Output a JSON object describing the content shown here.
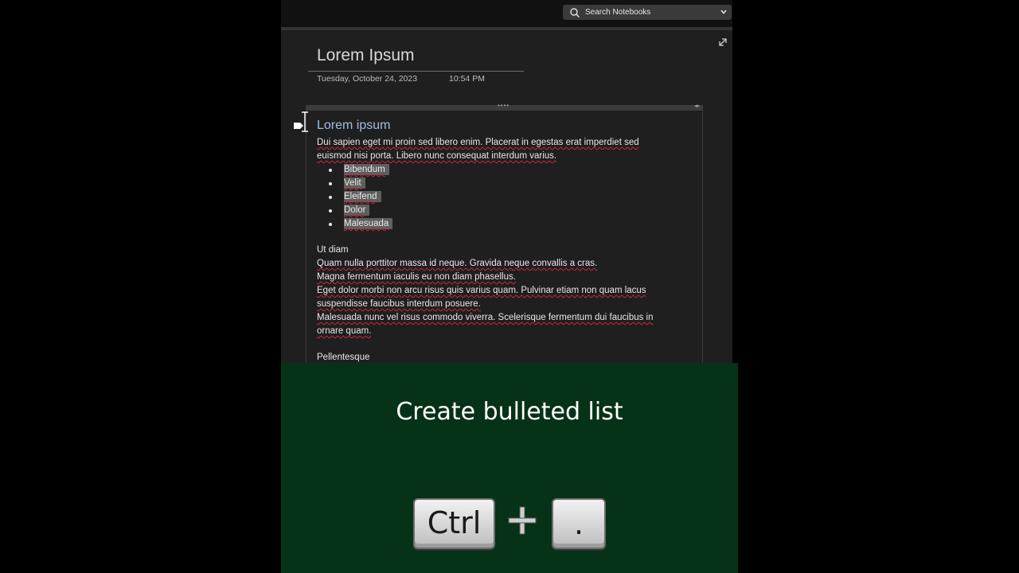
{
  "app": {
    "search": {
      "placeholder": "Search Notebooks",
      "icon": "search-icon",
      "dropdown_icon": "chevron-down-icon"
    },
    "expand_icon": "expand-icon"
  },
  "page": {
    "title": "Lorem Ipsum",
    "date": "Tuesday, October 24, 2023",
    "time": "10:54 PM"
  },
  "note": {
    "heading": "Lorem ipsum",
    "intro_lines": [
      "Dui sapien eget mi proin sed libero enim. Placerat in egestas erat imperdiet sed",
      "euismod nisi porta. Libero nunc consequat interdum varius."
    ],
    "bullets": [
      "Bibendum",
      "Velit",
      "Eleifend",
      "Dolor",
      "Malesuada"
    ],
    "section2_title": "Ut diam",
    "section2_lines": [
      "Quam nulla porttitor massa id neque. Gravida neque convallis a cras.",
      "Magna fermentum iaculis eu non diam phasellus.",
      "Eget dolor morbi non arcu risus quis varius quam. Pulvinar etiam non quam lacus",
      "suspendisse faucibus interdum posuere.",
      "Malesuada nunc vel risus commodo viverra. Scelerisque fermentum dui faucibus in",
      "ornare quam."
    ],
    "section3_title": "Pellentesque"
  },
  "caption": {
    "text": "Create bulleted list",
    "keys": [
      "Ctrl",
      "."
    ],
    "plus_icon": "plus-icon"
  },
  "colors": {
    "app_background": "#1f1f1f",
    "heading_blue": "#9fbfe0",
    "selection_gray": "#5e5e5e",
    "spellcheck_red": "#d0263a",
    "caption_panel_green": "#063217"
  }
}
